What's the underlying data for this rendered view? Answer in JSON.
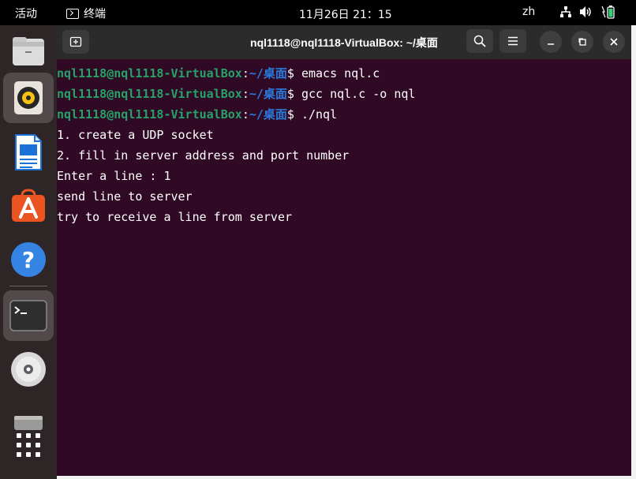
{
  "topbar": {
    "activities": "活动",
    "app_name": "终端",
    "clock": "11月26日  21：15",
    "lang": "zh",
    "tray_icons": [
      "network-icon",
      "volume-icon",
      "battery-icon"
    ]
  },
  "dock": {
    "items": [
      "files-icon",
      "rhythmbox-icon",
      "writer-icon",
      "software-icon",
      "help-icon",
      "terminal-icon",
      "disc-icon",
      "drive-icon",
      "show-apps-icon"
    ]
  },
  "window": {
    "title": "nql1118@nql1118-VirtualBox: ~/桌面",
    "buttons": [
      "new-tab",
      "search",
      "menu",
      "minimize",
      "maximize",
      "close"
    ]
  },
  "terminal": {
    "prompt_user": "nql1118@nql1118-VirtualBox",
    "prompt_sep": ":",
    "prompt_path": "~/桌面",
    "prompt_symbol": "$ ",
    "commands": [
      "emacs nql.c",
      "gcc nql.c -o nql",
      "./nql"
    ],
    "output": [
      "1. create a UDP socket",
      "2. fill in server address and port number",
      "Enter a line : 1",
      "send line to server",
      "try to receive a line from server"
    ]
  },
  "colors": {
    "terminal_bg": "#300a24",
    "prompt_user": "#26a269",
    "prompt_path": "#2a7bde",
    "accent": "#e95420"
  }
}
